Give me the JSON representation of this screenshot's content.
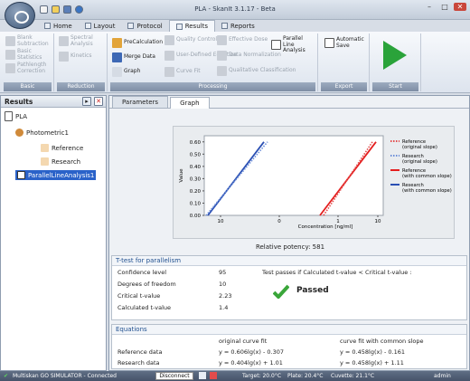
{
  "window": {
    "title": "PLA - SkanIt 3.1.17 - Beta",
    "min": "–",
    "max": "□",
    "close": "✕"
  },
  "ribbon_tabs": [
    {
      "label": "Home"
    },
    {
      "label": "Layout"
    },
    {
      "label": "Protocol"
    },
    {
      "label": "Results"
    },
    {
      "label": "Reports"
    }
  ],
  "ribbon": {
    "basic": {
      "label": "Basic",
      "blank": "Blank Subtraction",
      "basic_stats": "Basic Statistics",
      "pathlength": "Pathlength Correction"
    },
    "reduction": {
      "label": "Reduction",
      "spectral": "Spectral Analysis",
      "kinetics": "Kinetics"
    },
    "processing": {
      "label": "Processing",
      "precalc": "PreCalculation",
      "merge": "Merge Data",
      "graph": "Graph",
      "qc": "Quality Control",
      "udf": "User-Defined Equation",
      "curvefit": "Curve Fit",
      "ed": "Effective Dose",
      "norm": "Data Normalization",
      "qual": "Qualitative Classification",
      "pla": "Parallel Line Analysis"
    },
    "export": {
      "label": "Export",
      "autosave": "Automatic Save"
    },
    "start": {
      "label": "Start"
    }
  },
  "results_panel": {
    "title": "Results",
    "tree": [
      "PLA",
      "Photometric1",
      "Reference",
      "Research",
      "ParallelLineAnalysis1"
    ]
  },
  "content_tabs": [
    "Parameters",
    "Graph"
  ],
  "chart_data": {
    "type": "line",
    "xlabel": "Concentration [ng/ml]",
    "ylabel": "Value",
    "xticks": [
      "10",
      "0",
      "1",
      "10"
    ],
    "yticks": [
      "0.00",
      "0.10",
      "0.20",
      "0.30",
      "0.40",
      "0.50",
      "0.60"
    ],
    "ylim": [
      0,
      0.65
    ],
    "series": [
      {
        "name": "Reference (original slope)",
        "color": "#e34c4c",
        "style": "dotted"
      },
      {
        "name": "Research (original slope)",
        "color": "#6c8ed8",
        "style": "dotted"
      },
      {
        "name": "Reference (with common slope)",
        "color": "#e41e1e",
        "style": "solid"
      },
      {
        "name": "Research (with common slope)",
        "color": "#2a4fb3",
        "style": "solid"
      }
    ],
    "grid": false,
    "legend": "right"
  },
  "relative_potency": "Relative potency:  581",
  "ttest": {
    "title": "T-test for parallelism",
    "rows": [
      {
        "label": "Confidence level",
        "value": "95"
      },
      {
        "label": "Degrees of freedom",
        "value": "10"
      },
      {
        "label": "Critical t-value",
        "value": "2.23"
      },
      {
        "label": "Calculated t-value",
        "value": "1.4"
      }
    ],
    "rule": "Test passes if Calculated t-value < Critical t-value :",
    "result": "Passed"
  },
  "equations": {
    "title": "Equations",
    "col1": "original curve fit",
    "col2": "curve fit with common slope",
    "rows": [
      {
        "label": "Reference data",
        "orig": "y = 0.606lg(x) - 0.307",
        "common": "y = 0.458lg(x) - 0.161"
      },
      {
        "label": "Research data",
        "orig": "y = 0.404lg(x) + 1.01",
        "common": "y = 0.458lg(x) + 1.11"
      }
    ]
  },
  "status": {
    "instrument": "Multiskan GO SIMULATOR - Connected",
    "disconnect": "Disconnect",
    "target": "Target: 20.0°C",
    "plate": "Plate: 20.4°C",
    "cuvette": "Cuvette: 21.1°C",
    "user": "admin"
  }
}
